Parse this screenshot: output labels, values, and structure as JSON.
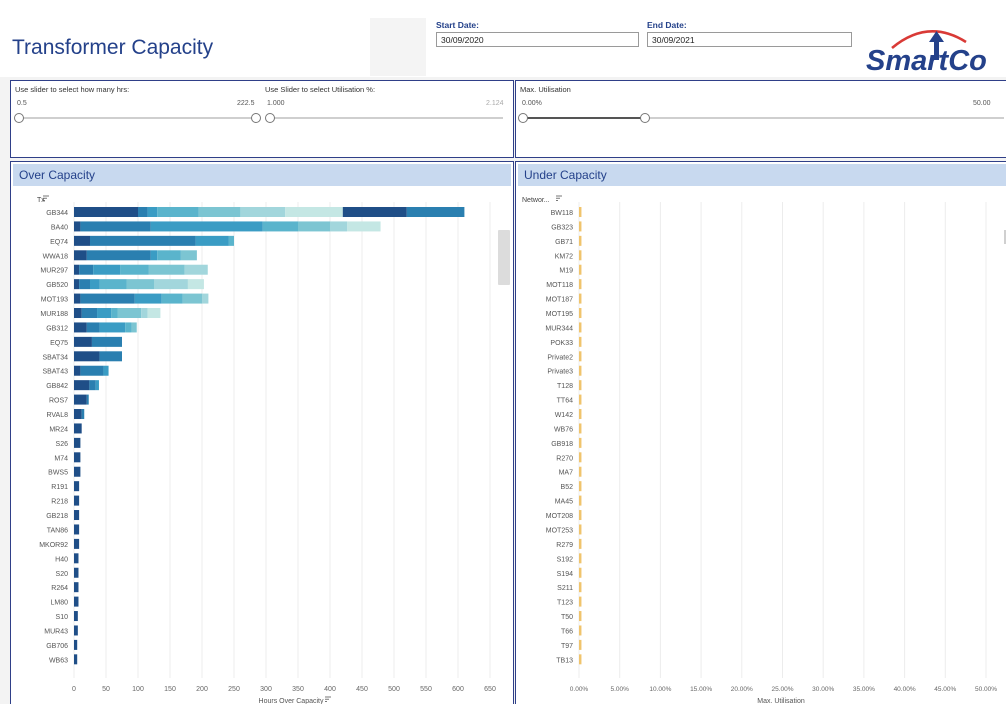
{
  "header": {
    "title": "Transformer Capacity",
    "start_date_label": "Start Date:",
    "start_date_value": "30/09/2020",
    "end_date_label": "End Date:",
    "end_date_value": "30/09/2021",
    "logo_text": "SmartCo"
  },
  "sliders": {
    "hours": {
      "title": "Use slider to select how many hrs:",
      "min": "0.5",
      "max": "222.5"
    },
    "util": {
      "title": "Use Slider to select Utilisation %:",
      "min": "1.000",
      "max": "2.124"
    },
    "maxutil": {
      "title": "Max. Utilisation",
      "min": "0.00%",
      "max": "50.00",
      "selected_fraction": 0.255
    }
  },
  "colors": {
    "panel_border": "#2f3f88",
    "title_blue": "#24418a",
    "visual_header": "#c8d9ef",
    "segment_palette": [
      "#1f4e87",
      "#2a7fb0",
      "#3a9cc4",
      "#5ab4cc",
      "#7cc5d2",
      "#a2d6dc",
      "#c4e7e4"
    ],
    "under_bar": "#f0c46c"
  },
  "over_capacity": {
    "title": "Over Capacity",
    "field_label": "Tx",
    "sort_icon": "sort-icon",
    "scrollbar_icon": "scrollbar",
    "chart_data": {
      "type": "bar",
      "orientation": "horizontal",
      "stacked": true,
      "xlabel": "Hours Over Capacity",
      "ylabel": "Tx",
      "xlim": [
        0,
        650
      ],
      "xticks": [
        0,
        50,
        100,
        150,
        200,
        250,
        300,
        350,
        400,
        450,
        500,
        550,
        600,
        650
      ],
      "categories": [
        "GB344",
        "BA40",
        "EQ74",
        "WWA18",
        "MUR297",
        "GB520",
        "MOT193",
        "MUR188",
        "GB312",
        "EQ75",
        "SBAT34",
        "SBAT43",
        "GB842",
        "ROS7",
        "RVAL8",
        "MR24",
        "S26",
        "M74",
        "BWS5",
        "R191",
        "R218",
        "GB218",
        "TAN86",
        "MKOR92",
        "H40",
        "S20",
        "R264",
        "LM80",
        "S10",
        "MUR43",
        "GB706",
        "WB63"
      ],
      "segments": [
        [
          100,
          15,
          15,
          65,
          65,
          70,
          90,
          100,
          90
        ],
        [
          10,
          110,
          175,
          55,
          50,
          27,
          52
        ],
        [
          25,
          165,
          52,
          8
        ],
        [
          20,
          100,
          10,
          37,
          25
        ],
        [
          8,
          22,
          42,
          45,
          56,
          36
        ],
        [
          8,
          17,
          15,
          42,
          43,
          53,
          25
        ],
        [
          10,
          85,
          42,
          33,
          30,
          10
        ],
        [
          12,
          24,
          22,
          10,
          37,
          10,
          20
        ],
        [
          20,
          20,
          40,
          10,
          8
        ],
        [
          28,
          47
        ],
        [
          40,
          35
        ],
        [
          10,
          36,
          8
        ],
        [
          24,
          10,
          5
        ],
        [
          20,
          3
        ],
        [
          12,
          4
        ],
        [
          12
        ],
        [
          10
        ],
        [
          10
        ],
        [
          10
        ],
        [
          8
        ],
        [
          8
        ],
        [
          8
        ],
        [
          8
        ],
        [
          8
        ],
        [
          7
        ],
        [
          7
        ],
        [
          7
        ],
        [
          7
        ],
        [
          6
        ],
        [
          6
        ],
        [
          5
        ],
        [
          5
        ]
      ]
    }
  },
  "under_capacity": {
    "title": "Under Capacity",
    "field_label": "Networ...",
    "chart_data": {
      "type": "bar",
      "orientation": "horizontal",
      "xlabel": "Max. Utilisation",
      "ylabel": "Networ...",
      "xlim": [
        0,
        0.5
      ],
      "xticks": [
        "0.00%",
        "5.00%",
        "10.00%",
        "15.00%",
        "20.00%",
        "25.00%",
        "30.00%",
        "35.00%",
        "40.00%",
        "45.00%",
        "50.00%"
      ],
      "categories": [
        "BW118",
        "GB323",
        "GB71",
        "KM72",
        "M19",
        "MOT118",
        "MOT187",
        "MOT195",
        "MUR344",
        "POK33",
        "Private2",
        "Private3",
        "T128",
        "TT64",
        "W142",
        "WB76",
        "GB918",
        "R270",
        "MA7",
        "B52",
        "MA45",
        "MOT208",
        "MOT253",
        "R279",
        "S192",
        "S194",
        "S211",
        "T123",
        "T50",
        "T66",
        "T97",
        "TB13"
      ],
      "values": [
        0.003,
        0.003,
        0.003,
        0.003,
        0.003,
        0.003,
        0.003,
        0.003,
        0.003,
        0.003,
        0.003,
        0.003,
        0.003,
        0.003,
        0.003,
        0.003,
        0.003,
        0.003,
        0.003,
        0.003,
        0.003,
        0.003,
        0.003,
        0.003,
        0.003,
        0.003,
        0.003,
        0.003,
        0.003,
        0.003,
        0.003,
        0.003
      ]
    }
  }
}
